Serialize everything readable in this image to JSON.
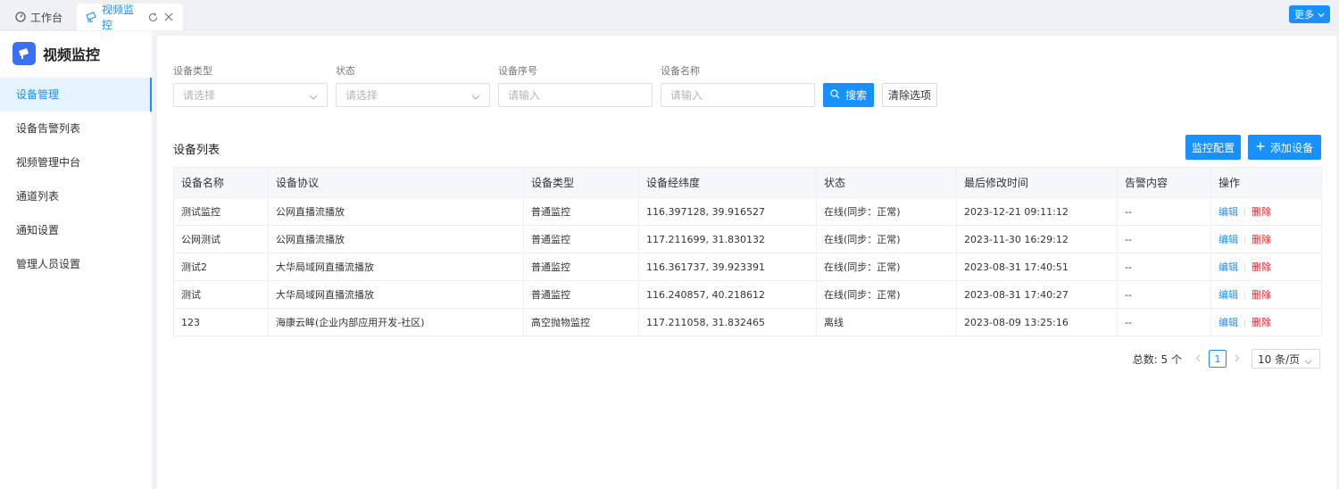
{
  "tabs": {
    "home": "工作台",
    "active": "视频监控",
    "more": "更多"
  },
  "sidebar": {
    "title": "视频监控",
    "items": [
      "设备管理",
      "设备告警列表",
      "视频管理中台",
      "通道列表",
      "通知设置",
      "管理人员设置"
    ]
  },
  "filters": {
    "type_label": "设备类型",
    "type_placeholder": "请选择",
    "status_label": "状态",
    "status_placeholder": "请选择",
    "serial_label": "设备序号",
    "serial_placeholder": "请输入",
    "name_label": "设备名称",
    "name_placeholder": "请输入",
    "search": "搜索",
    "clear": "清除选项"
  },
  "list": {
    "title": "设备列表",
    "config_button": "监控配置",
    "add_button": "添加设备",
    "columns": [
      "设备名称",
      "设备协议",
      "设备类型",
      "设备经纬度",
      "状态",
      "最后修改时间",
      "告警内容",
      "操作"
    ],
    "rows": [
      [
        "测试监控",
        "公网直播流播放",
        "普通监控",
        "116.397128, 39.916527",
        "在线(同步：正常)",
        "2023-12-21 09:11:12",
        "--"
      ],
      [
        "公网测试",
        "公网直播流播放",
        "普通监控",
        "117.211699, 31.830132",
        "在线(同步：正常)",
        "2023-11-30 16:29:12",
        "--"
      ],
      [
        "测试2",
        "大华局域网直播流播放",
        "普通监控",
        "116.361737, 39.923391",
        "在线(同步：正常)",
        "2023-08-31 17:40:51",
        "--"
      ],
      [
        "测试",
        "大华局域网直播流播放",
        "普通监控",
        "116.240857, 40.218612",
        "在线(同步：正常)",
        "2023-08-31 17:40:27",
        "--"
      ],
      [
        "123",
        "海康云眸(企业内部应用开发-社区)",
        "高空抛物监控",
        "117.211058, 31.832465",
        "离线",
        "2023-08-09 13:25:16",
        "--"
      ]
    ],
    "edit": "编辑",
    "delete": "删除"
  },
  "pagination": {
    "total": "总数: 5 个",
    "current_page": "1",
    "page_size": "10 条/页"
  },
  "colors": {
    "primary": "#1890ff",
    "danger": "#f5222d",
    "brand": "#3b6ff5"
  }
}
